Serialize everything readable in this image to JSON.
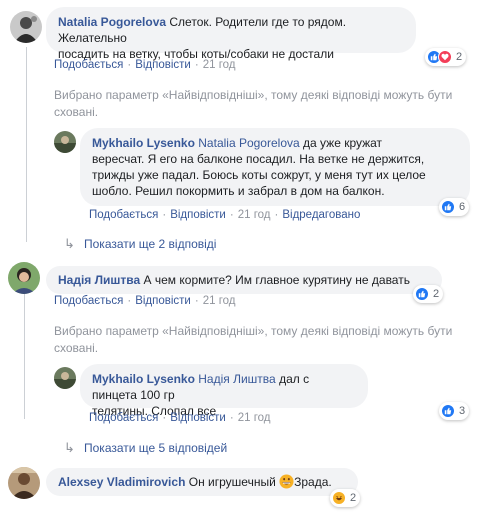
{
  "comments": [
    {
      "author": "Natalia Pogorelova",
      "text_line1": "Слеток. Родители где то рядом. Желательно",
      "text_line2": "посадить на ветку, чтобы коты/собаки не достали",
      "like_label": "Подобається",
      "reply_label": "Відповісти",
      "time": "21 год",
      "reaction_count": "2",
      "reactions": [
        "like-icon",
        "love-icon"
      ]
    },
    {
      "author": "Надія Лиштва",
      "text": "А чем кормите? Им главное курятину не давать",
      "like_label": "Подобається",
      "reply_label": "Відповісти",
      "time": "21 год",
      "reaction_count": "2",
      "reactions": [
        "like-icon"
      ]
    },
    {
      "author": "Alexsey Vladimirovich",
      "text_before": "Он игрушечный ",
      "text_after": "Зрада.",
      "reaction_count": "2",
      "reactions": [
        "haha-icon"
      ]
    }
  ],
  "replies": [
    {
      "author": "Mykhailo Lysenko",
      "reply_to": "Natalia Pogorelova",
      "text_line1": "да уже кружат",
      "text_line2": "вересчат. Я его на балконе посадил. На ветке не держится,",
      "text_line3": "трижды уже падал. Боюсь коты сожрут, у меня тут их целое",
      "text_line4": "шобло. Решил покормить и забрал в дом на балкон.",
      "like_label": "Подобається",
      "reply_label": "Відповісти",
      "time": "21 год",
      "edited_label": "Відредаговано",
      "reaction_count": "6",
      "reactions": [
        "like-icon"
      ]
    },
    {
      "author": "Mykhailo Lysenko",
      "reply_to": "Надія Лиштва",
      "text_line1": "дал с пинцета 100 гр",
      "text_line2": "телятины. Слопал все",
      "like_label": "Подобається",
      "reply_label": "Відповісти",
      "time": "21 год",
      "reaction_count": "3",
      "reactions": [
        "like-icon"
      ]
    }
  ],
  "notices": {
    "line1": "Вибрано параметр «Найвідповідніші», тому деякі відповіді можуть бути",
    "line2": "сховані."
  },
  "more_replies": [
    {
      "label": "Показати ще 2 відповіді"
    },
    {
      "label": "Показати ще 5 відповідей"
    }
  ],
  "colors": {
    "link": "#385898",
    "meta": "#90949c",
    "bubble": "#f2f3f5",
    "like": "#2078f4",
    "love": "#f33e58",
    "haha": "#f7b125"
  }
}
